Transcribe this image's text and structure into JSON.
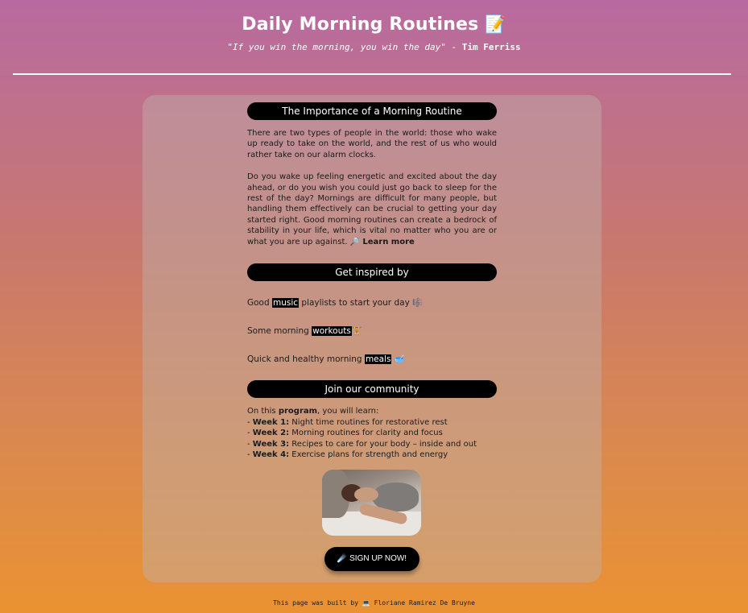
{
  "header": {
    "title": "Daily Morning Routines",
    "title_emoji": "📝",
    "quote": "\"If you win the morning, you win the day\"",
    "quote_dash": " - ",
    "quote_author": "Tim Ferriss"
  },
  "importance": {
    "heading": "The Importance of a Morning Routine",
    "para1": "There are two types of people in the world: those who wake up ready to take on the world, and the rest of us who would rather take on our alarm clocks.",
    "para2": "Do you wake up feeling energetic and excited about the day ahead, or do you wish you could just go back to sleep for the rest of the day? Mornings are difficult for many people, but handling them effectively can be crucial to getting your day started right. Good morning routines can create a bedrock of stability in your life, which is vital no matter who you are or what you are up against.",
    "learn_icon": "🔎",
    "learn_more": "Learn more"
  },
  "inspired": {
    "heading": "Get inspired by",
    "items": [
      {
        "before": "Good ",
        "link": "music",
        "after": " playlists to start your day ",
        "emoji": "🎼"
      },
      {
        "before": "Some morning ",
        "link": "workouts",
        "after": "",
        "emoji": "🏋️"
      },
      {
        "before": "Quick and healthy morning ",
        "link": "meals",
        "after": " ",
        "emoji": "🥣"
      }
    ]
  },
  "community": {
    "heading": "Join our community",
    "intro_before": "On this ",
    "intro_bold": "program",
    "intro_after": ", you will learn:",
    "weeks": [
      {
        "label": "Week 1:",
        "text": " Night time routines for restorative rest"
      },
      {
        "label": "Week 2:",
        "text": " Morning routines for clarity and focus"
      },
      {
        "label": "Week 3:",
        "text": " Recipes to care for your body – inside and out"
      },
      {
        "label": "Week 4:",
        "text": " Exercise plans for strength and energy"
      }
    ],
    "image_description": "woman-sleeping-photo",
    "signup_icon": "☄️",
    "signup_label": "SIGN UP NOW!"
  },
  "footer": {
    "text_before": "This page was built by ",
    "icon": "💻",
    "author": " Floriane Ramirez De Bruyne"
  }
}
